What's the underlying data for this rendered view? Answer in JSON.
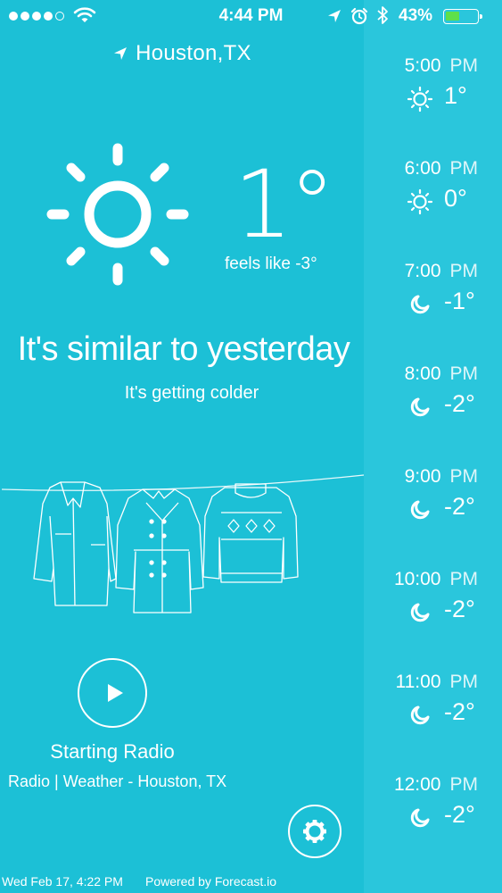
{
  "status_bar": {
    "time": "4:44 PM",
    "battery_percent": "43%",
    "signal_bars_filled": 4,
    "battery_level": 0.43
  },
  "location": "Houston,TX",
  "current": {
    "temperature": "1°",
    "feels_like": "feels like -3°",
    "condition_icon": "sun-icon"
  },
  "summary": {
    "headline": "It's similar to yesterday",
    "subline": "It's getting colder"
  },
  "clothing": [
    "jacket-icon",
    "coat-icon",
    "sweater-icon"
  ],
  "radio": {
    "title": "Starting Radio",
    "subtitle": "Radio | Weather - Houston, TX"
  },
  "footer": {
    "date": "Wed Feb 17, 4:22 PM",
    "powered_by": "Powered by Forecast.io"
  },
  "hourly": [
    {
      "time": "5:00",
      "ampm": "PM",
      "temp": "1°",
      "icon": "sun-icon"
    },
    {
      "time": "6:00",
      "ampm": "PM",
      "temp": "0°",
      "icon": "sun-icon"
    },
    {
      "time": "7:00",
      "ampm": "PM",
      "temp": "-1°",
      "icon": "moon-icon"
    },
    {
      "time": "8:00",
      "ampm": "PM",
      "temp": "-2°",
      "icon": "moon-icon"
    },
    {
      "time": "9:00",
      "ampm": "PM",
      "temp": "-2°",
      "icon": "moon-icon"
    },
    {
      "time": "10:00",
      "ampm": "PM",
      "temp": "-2°",
      "icon": "moon-icon"
    },
    {
      "time": "11:00",
      "ampm": "PM",
      "temp": "-2°",
      "icon": "moon-icon"
    },
    {
      "time": "12:00",
      "ampm": "PM",
      "temp": "-2°",
      "icon": "moon-icon"
    }
  ],
  "colors": {
    "background": "#1cc0d6",
    "sidebar": "#2ac6dc",
    "battery_fill": "#5ee04a"
  }
}
